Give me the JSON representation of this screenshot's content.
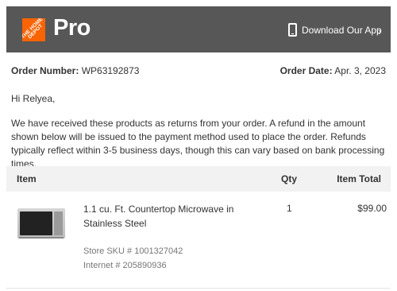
{
  "header": {
    "logo_text": "THE HOME DEPOT",
    "brand": "Pro",
    "download_label": "Download Our App",
    "chevron": "›",
    "icons": [
      "phone-icon",
      "chevron-right-icon"
    ],
    "colors": {
      "header_bg": "#575757",
      "logo_orange": "#f96302"
    }
  },
  "order": {
    "number_label": "Order Number:",
    "number": "WP63192873",
    "date_label": "Order Date:",
    "date": "Apr. 3, 2023"
  },
  "greeting": "Hi Relyea,",
  "message": "We have received these products as returns from your order. A refund in the amount shown below will be issued to the payment method used to place the order. Refunds typically reflect within 3-5 business days, though this can vary based on bank processing times.",
  "table": {
    "headers": {
      "item": "Item",
      "qty": "Qty",
      "total": "Item Total"
    },
    "rows": [
      {
        "name": "1.1 cu. Ft. Countertop Microwave in Stainless Steel",
        "qty": "1",
        "total": "$99.00",
        "sku": "Store SKU # 1001327042",
        "internet": "Internet # 205890936",
        "image": "microwave-image"
      }
    ]
  }
}
